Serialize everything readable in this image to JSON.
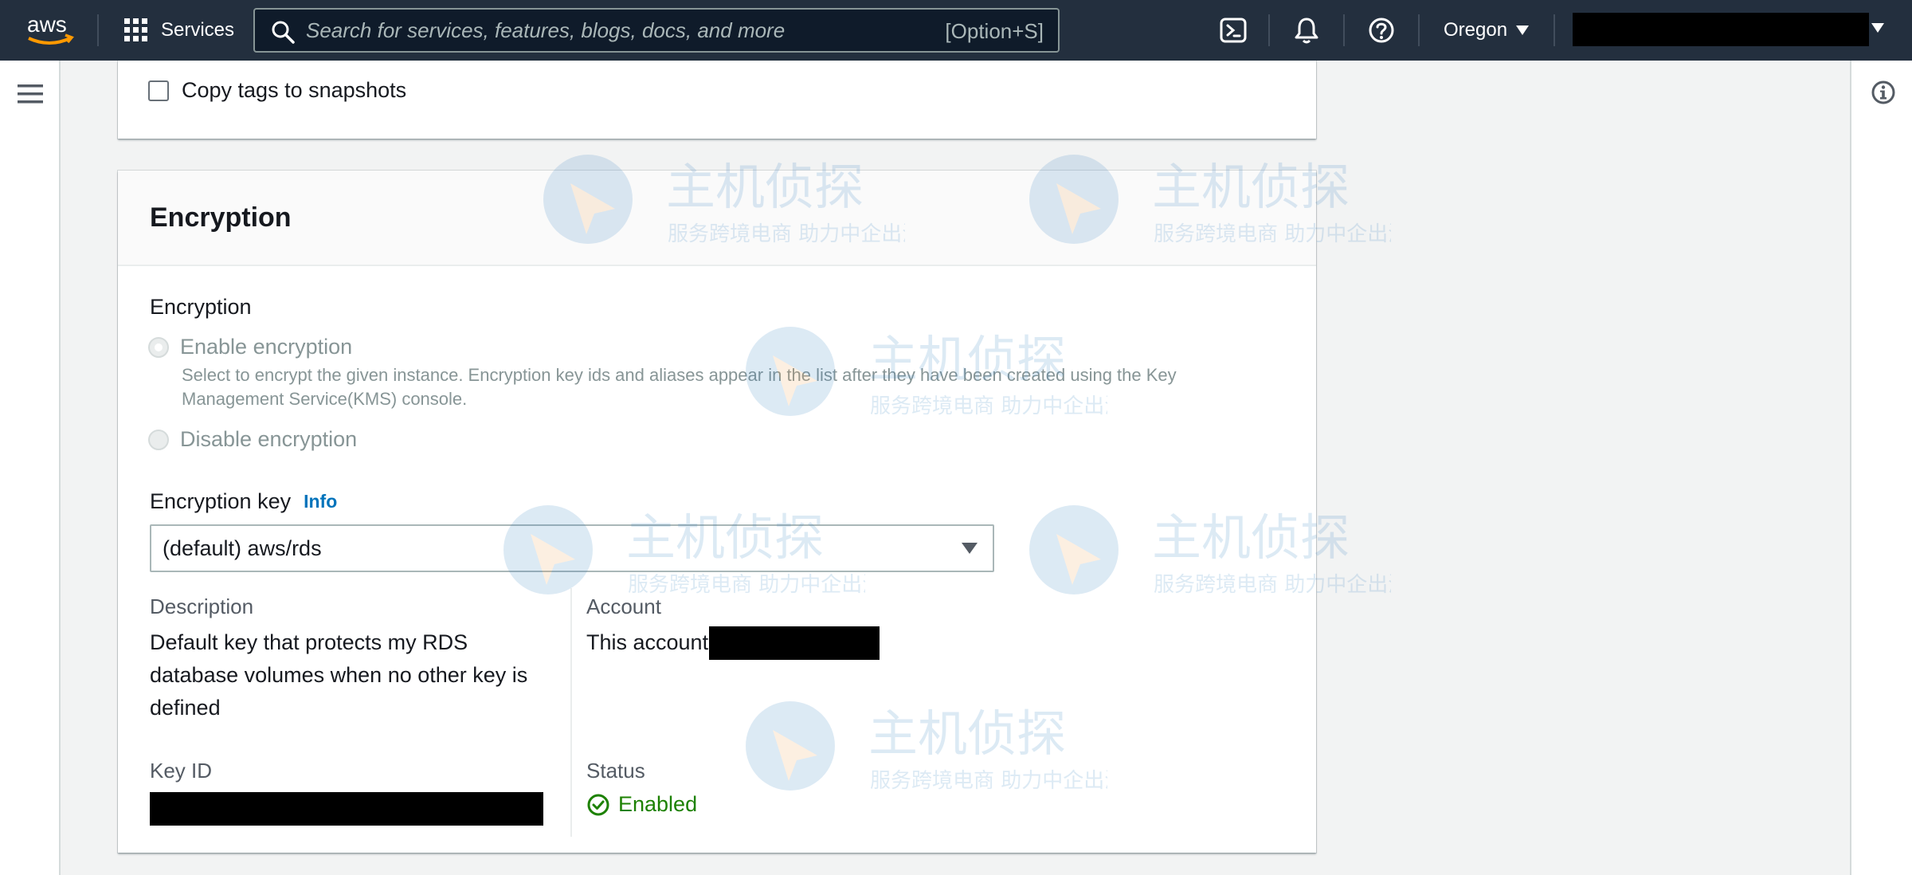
{
  "topnav": {
    "logo_text": "aws",
    "services_label": "Services",
    "search": {
      "placeholder": "Search for services, features, blogs, docs, and more",
      "value": "",
      "shortcut": "[Option+S]"
    },
    "region": "Oregon",
    "icons": [
      "grid-icon",
      "search-icon",
      "cloudshell-icon",
      "bell-icon",
      "help-icon",
      "caret-down-icon"
    ],
    "colors": {
      "background": "#232f3e",
      "accent": "#ff9900"
    }
  },
  "backup_card": {
    "copy_tags_label": "Copy tags to snapshots",
    "copy_tags_checked": false
  },
  "encryption_card": {
    "title": "Encryption",
    "encryption_field_label": "Encryption",
    "options": [
      {
        "label": "Enable encryption",
        "selected": true,
        "disabled": true,
        "description_line1": "Select to encrypt the given instance. Encryption key ids and aliases appear in the list after they have been created using the Key",
        "description_line2": "Management Service(KMS) console."
      },
      {
        "label": "Disable encryption",
        "selected": false,
        "disabled": true
      }
    ],
    "key_field": {
      "label": "Encryption key",
      "info_label": "Info",
      "selected_value": "(default) aws/rds"
    },
    "details": {
      "description_label": "Description",
      "description_line1": "Default key that protects my RDS",
      "description_line2": "database volumes when no other key is",
      "description_line3": "defined",
      "account_label": "Account",
      "account_value": "This account",
      "key_id_label": "Key ID",
      "status_label": "Status",
      "status_value": "Enabled"
    },
    "colors": {
      "link": "#0073bb",
      "success": "#1d8102",
      "disabled": "#879596"
    }
  },
  "watermark": {
    "brand": "主机侦探",
    "tagline": "服务跨境电商 助力中企出海"
  }
}
